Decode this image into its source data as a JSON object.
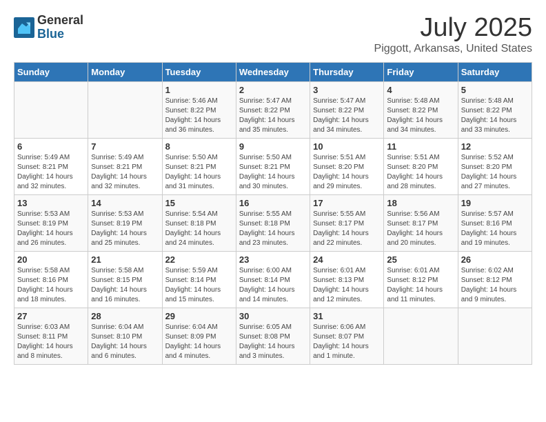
{
  "logo": {
    "general": "General",
    "blue": "Blue"
  },
  "title": "July 2025",
  "subtitle": "Piggott, Arkansas, United States",
  "headers": [
    "Sunday",
    "Monday",
    "Tuesday",
    "Wednesday",
    "Thursday",
    "Friday",
    "Saturday"
  ],
  "weeks": [
    [
      {
        "day": "",
        "info": ""
      },
      {
        "day": "",
        "info": ""
      },
      {
        "day": "1",
        "info": "Sunrise: 5:46 AM\nSunset: 8:22 PM\nDaylight: 14 hours and 36 minutes."
      },
      {
        "day": "2",
        "info": "Sunrise: 5:47 AM\nSunset: 8:22 PM\nDaylight: 14 hours and 35 minutes."
      },
      {
        "day": "3",
        "info": "Sunrise: 5:47 AM\nSunset: 8:22 PM\nDaylight: 14 hours and 34 minutes."
      },
      {
        "day": "4",
        "info": "Sunrise: 5:48 AM\nSunset: 8:22 PM\nDaylight: 14 hours and 34 minutes."
      },
      {
        "day": "5",
        "info": "Sunrise: 5:48 AM\nSunset: 8:22 PM\nDaylight: 14 hours and 33 minutes."
      }
    ],
    [
      {
        "day": "6",
        "info": "Sunrise: 5:49 AM\nSunset: 8:21 PM\nDaylight: 14 hours and 32 minutes."
      },
      {
        "day": "7",
        "info": "Sunrise: 5:49 AM\nSunset: 8:21 PM\nDaylight: 14 hours and 32 minutes."
      },
      {
        "day": "8",
        "info": "Sunrise: 5:50 AM\nSunset: 8:21 PM\nDaylight: 14 hours and 31 minutes."
      },
      {
        "day": "9",
        "info": "Sunrise: 5:50 AM\nSunset: 8:21 PM\nDaylight: 14 hours and 30 minutes."
      },
      {
        "day": "10",
        "info": "Sunrise: 5:51 AM\nSunset: 8:20 PM\nDaylight: 14 hours and 29 minutes."
      },
      {
        "day": "11",
        "info": "Sunrise: 5:51 AM\nSunset: 8:20 PM\nDaylight: 14 hours and 28 minutes."
      },
      {
        "day": "12",
        "info": "Sunrise: 5:52 AM\nSunset: 8:20 PM\nDaylight: 14 hours and 27 minutes."
      }
    ],
    [
      {
        "day": "13",
        "info": "Sunrise: 5:53 AM\nSunset: 8:19 PM\nDaylight: 14 hours and 26 minutes."
      },
      {
        "day": "14",
        "info": "Sunrise: 5:53 AM\nSunset: 8:19 PM\nDaylight: 14 hours and 25 minutes."
      },
      {
        "day": "15",
        "info": "Sunrise: 5:54 AM\nSunset: 8:18 PM\nDaylight: 14 hours and 24 minutes."
      },
      {
        "day": "16",
        "info": "Sunrise: 5:55 AM\nSunset: 8:18 PM\nDaylight: 14 hours and 23 minutes."
      },
      {
        "day": "17",
        "info": "Sunrise: 5:55 AM\nSunset: 8:17 PM\nDaylight: 14 hours and 22 minutes."
      },
      {
        "day": "18",
        "info": "Sunrise: 5:56 AM\nSunset: 8:17 PM\nDaylight: 14 hours and 20 minutes."
      },
      {
        "day": "19",
        "info": "Sunrise: 5:57 AM\nSunset: 8:16 PM\nDaylight: 14 hours and 19 minutes."
      }
    ],
    [
      {
        "day": "20",
        "info": "Sunrise: 5:58 AM\nSunset: 8:16 PM\nDaylight: 14 hours and 18 minutes."
      },
      {
        "day": "21",
        "info": "Sunrise: 5:58 AM\nSunset: 8:15 PM\nDaylight: 14 hours and 16 minutes."
      },
      {
        "day": "22",
        "info": "Sunrise: 5:59 AM\nSunset: 8:14 PM\nDaylight: 14 hours and 15 minutes."
      },
      {
        "day": "23",
        "info": "Sunrise: 6:00 AM\nSunset: 8:14 PM\nDaylight: 14 hours and 14 minutes."
      },
      {
        "day": "24",
        "info": "Sunrise: 6:01 AM\nSunset: 8:13 PM\nDaylight: 14 hours and 12 minutes."
      },
      {
        "day": "25",
        "info": "Sunrise: 6:01 AM\nSunset: 8:12 PM\nDaylight: 14 hours and 11 minutes."
      },
      {
        "day": "26",
        "info": "Sunrise: 6:02 AM\nSunset: 8:12 PM\nDaylight: 14 hours and 9 minutes."
      }
    ],
    [
      {
        "day": "27",
        "info": "Sunrise: 6:03 AM\nSunset: 8:11 PM\nDaylight: 14 hours and 8 minutes."
      },
      {
        "day": "28",
        "info": "Sunrise: 6:04 AM\nSunset: 8:10 PM\nDaylight: 14 hours and 6 minutes."
      },
      {
        "day": "29",
        "info": "Sunrise: 6:04 AM\nSunset: 8:09 PM\nDaylight: 14 hours and 4 minutes."
      },
      {
        "day": "30",
        "info": "Sunrise: 6:05 AM\nSunset: 8:08 PM\nDaylight: 14 hours and 3 minutes."
      },
      {
        "day": "31",
        "info": "Sunrise: 6:06 AM\nSunset: 8:07 PM\nDaylight: 14 hours and 1 minute."
      },
      {
        "day": "",
        "info": ""
      },
      {
        "day": "",
        "info": ""
      }
    ]
  ]
}
